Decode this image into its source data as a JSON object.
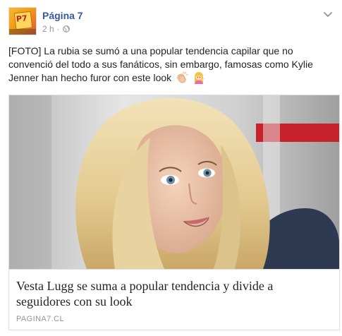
{
  "post": {
    "page_name": "Página 7",
    "avatar_label": "P7",
    "time": "2 h",
    "separator": "·",
    "privacy_icon": "globe-icon",
    "options_icon": "chevron-down-icon",
    "text": "[FOTO] La rubia se sumó a una popular tendencia capilar que no convenció del todo a sus fanáticos, sin embargo, famosas como Kylie Jenner han hecho furor con este look",
    "emojis": [
      "clapping-hands-icon",
      "woman-tipping-hand-icon"
    ]
  },
  "link_card": {
    "title": "Vesta Lugg se suma a popular tendencia y divide a seguidores con su look",
    "domain": "PAGINA7.CL"
  },
  "colors": {
    "link_blue": "#365899",
    "meta_gray": "#90949c",
    "text": "#1d2129",
    "border": "#dddfe2"
  }
}
